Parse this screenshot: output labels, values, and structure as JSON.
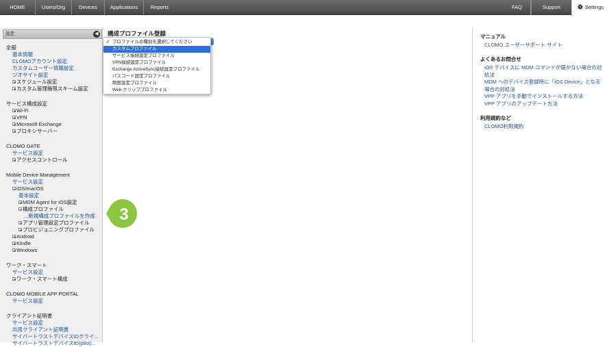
{
  "nav": {
    "home": "HOME",
    "users": "Users/Org",
    "devices": "Devices",
    "applications": "Applications",
    "reports": "Reports",
    "faq": "FAQ",
    "support": "Support",
    "settings": "Settings"
  },
  "sidebar": {
    "header": "設定",
    "collapse_glyph": "◀",
    "general": {
      "title": "全般",
      "items": [
        "基本情報",
        "CLOMOアカウント設定",
        "カスタムユーザー情報設定",
        "ジオサイト設定",
        "スケジュール設定",
        "カスタム管理権限スキーム設定"
      ]
    },
    "service": {
      "title": "サービス構成設定",
      "items": [
        "Wi-Fi",
        "VPN",
        "Microsoft Exchange",
        "プロキシサーバー"
      ]
    },
    "gate": {
      "title": "CLOMO GATE",
      "items": [
        "サービス設定",
        "アクセスコントロール"
      ]
    },
    "mdm": {
      "title": "Mobile Device Management",
      "service": "サービス設定",
      "ios": "iOS/macOS",
      "basic": "基本設定",
      "agent": "MDM Agent for iOS設定",
      "profile": "構成プロファイル",
      "new_profile": "...新規構成プロファイルを作成",
      "app_profile": "アプリ管理設定プロファイル",
      "provision": "プロビジョニングプロファイル",
      "android": "Android",
      "kindle": "Kindle",
      "windows": "Windows"
    },
    "work": {
      "title": "ワーク・スマート",
      "service": "サービス設定",
      "config": "ワーク・スマート構成"
    },
    "portal": {
      "title": "CLOMO MOBILE APP PORTAL",
      "service": "サービス設定"
    },
    "client": {
      "title": "クライアント証明書",
      "service": "サービス設定",
      "shared": "共用クライアント証明書",
      "cyber1": "サイバートラストデバイスIDクライ...",
      "cyber2": "サイバートラストデバイスID(pilot)..."
    }
  },
  "main": {
    "title": "構成プロファイル登録",
    "dropdown": {
      "options": [
        "プロファイルの種別を選択してください",
        "カスタムプロファイル",
        "サービス接続設定プロファイル",
        "VPN接続設定プロファイル",
        "Exchange ActiveSync接続設定プロファイル",
        "パスコード設定プロファイル",
        "制限設定プロファイル",
        "Web クリッププロファイル"
      ],
      "checked_index": 0,
      "highlight_index": 1
    },
    "callout_number": "3"
  },
  "right": {
    "manual": {
      "title": "マニュアル",
      "links": [
        "CLOMO ユーザーサポート サイト"
      ]
    },
    "faq": {
      "title": "よくあるお問合せ",
      "links": [
        "iOS デバイスに MDM コマンドが届かない場合の対",
        "処法",
        "MDM へのデバイス登録時に「iOS Device」となる",
        "場合の対処法",
        "VPP アプリを手動でインストールする方法",
        "VPP アプリのアップデート方法"
      ]
    },
    "terms": {
      "title": "利用規約など",
      "links": [
        "CLOMO利用規約"
      ]
    }
  },
  "colors": {
    "nav_bg": "#555555",
    "link": "#1a4f9c",
    "callout": "#8cc63f",
    "highlight": "#2f6fdc"
  }
}
